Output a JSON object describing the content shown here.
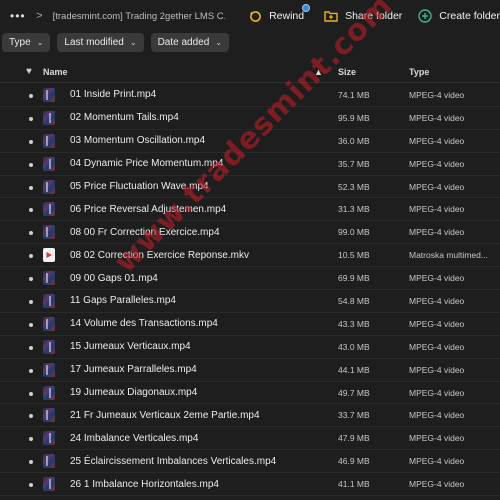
{
  "toolbar": {
    "more_icon": "more-horizontal-icon",
    "separator": ">",
    "breadcrumb": "[tradesmint.com] Trading 2gether LMS C...",
    "rewind_label": "Rewind",
    "share_folder_label": "Share folder",
    "create_label": "Create folder"
  },
  "filters": {
    "type_label": "Type",
    "last_modified_label": "Last modified",
    "date_added_label": "Date added"
  },
  "table": {
    "name_header": "Name",
    "size_header": "Size",
    "type_header": "Type",
    "sort_indicator": "▲",
    "rows": [
      {
        "name": "01 Inside Print.mp4",
        "size": "74.1 MB",
        "type": "MPEG-4 video",
        "kind": "video"
      },
      {
        "name": "02 Momentum Tails.mp4",
        "size": "95.9 MB",
        "type": "MPEG-4 video",
        "kind": "video"
      },
      {
        "name": "03 Momentum Oscillation.mp4",
        "size": "36.0 MB",
        "type": "MPEG-4 video",
        "kind": "video"
      },
      {
        "name": "04 Dynamic Price Momentum.mp4",
        "size": "35.7 MB",
        "type": "MPEG-4 video",
        "kind": "video"
      },
      {
        "name": "05 Price Fluctuation Wave.mp4",
        "size": "52.3 MB",
        "type": "MPEG-4 video",
        "kind": "video"
      },
      {
        "name": "06 Price Reversal Adjustemen.mp4",
        "size": "31.3 MB",
        "type": "MPEG-4 video",
        "kind": "video"
      },
      {
        "name": "08 00 Fr Correction Exercice.mp4",
        "size": "99.0 MB",
        "type": "MPEG-4 video",
        "kind": "video"
      },
      {
        "name": "08 02 Correction Exercice Reponse.mkv",
        "size": "10.5 MB",
        "type": "Matroska multimed...",
        "kind": "mkv"
      },
      {
        "name": "09 00 Gaps 01.mp4",
        "size": "69.9 MB",
        "type": "MPEG-4 video",
        "kind": "video"
      },
      {
        "name": "11 Gaps Paralleles.mp4",
        "size": "54.8 MB",
        "type": "MPEG-4 video",
        "kind": "video"
      },
      {
        "name": "14 Volume des Transactions.mp4",
        "size": "43.3 MB",
        "type": "MPEG-4 video",
        "kind": "video"
      },
      {
        "name": "15 Jumeaux Verticaux.mp4",
        "size": "43.0 MB",
        "type": "MPEG-4 video",
        "kind": "video"
      },
      {
        "name": "17 Jumeaux Parralleles.mp4",
        "size": "44.1 MB",
        "type": "MPEG-4 video",
        "kind": "video"
      },
      {
        "name": "19 Jumeaux Diagonaux.mp4",
        "size": "49.7 MB",
        "type": "MPEG-4 video",
        "kind": "video"
      },
      {
        "name": "21 Fr Jumeaux Verticaux 2eme Partie.mp4",
        "size": "33.7 MB",
        "type": "MPEG-4 video",
        "kind": "video"
      },
      {
        "name": "24 Imbalance Verticales.mp4",
        "size": "47.9 MB",
        "type": "MPEG-4 video",
        "kind": "video"
      },
      {
        "name": "25 Éclaircissement Imbalances Verticales.mp4",
        "size": "46.9 MB",
        "type": "MPEG-4 video",
        "kind": "video"
      },
      {
        "name": "26 1 Imbalance Horizontales.mp4",
        "size": "41.1 MB",
        "type": "MPEG-4 video",
        "kind": "video"
      }
    ]
  },
  "watermark": "www.tradesmint.com",
  "colors": {
    "background": "#1e1e1e",
    "chip": "#3a3a3a",
    "badge": "#3d8bd8",
    "folder_icon": "#e8b321",
    "create_icon": "#3fb68b",
    "mkv_play": "#e0343b",
    "watermark": "#c81e28"
  }
}
